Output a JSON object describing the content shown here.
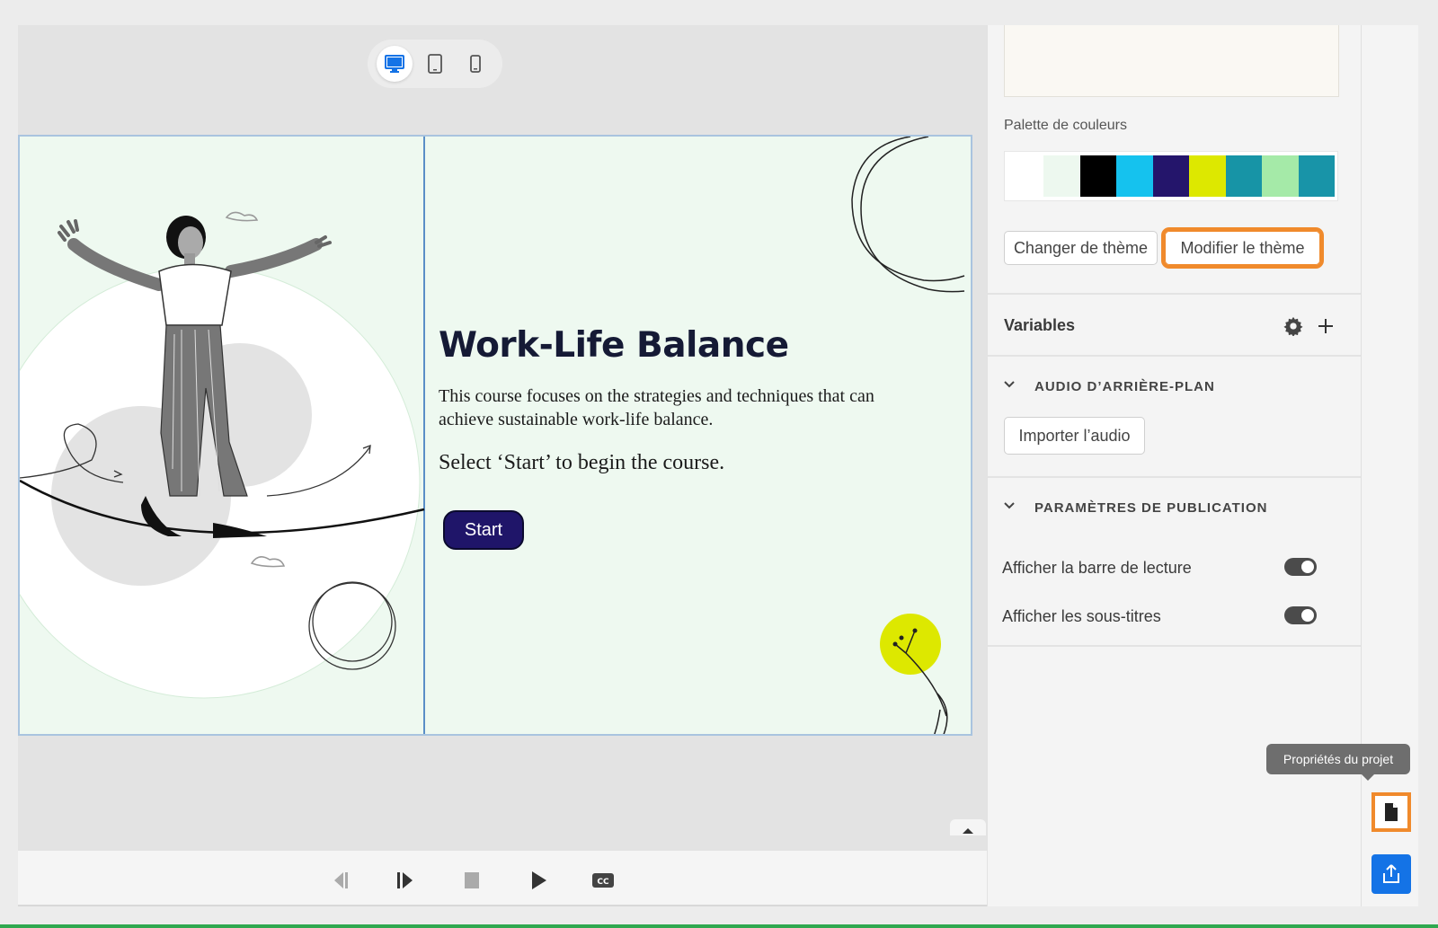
{
  "device_modes": [
    {
      "icon": "desktop-icon",
      "active": true
    },
    {
      "icon": "tablet-icon",
      "active": false
    },
    {
      "icon": "mobile-icon",
      "active": false
    }
  ],
  "slide": {
    "title": "Work-Life Balance",
    "description": "This course focuses on the strategies and techniques that can achieve sustainable work-life balance.",
    "cta": "Select ‘Start’ to begin the course.",
    "start_label": "Start"
  },
  "playbar": {
    "buttons": [
      "previous-icon",
      "next-icon",
      "stop-icon",
      "play-icon",
      "closed-captions-icon"
    ],
    "cc_label": "CC"
  },
  "properties": {
    "palette_label": "Palette de couleurs",
    "palette": [
      "#ffffff",
      "#edf8ef",
      "#000000",
      "#15c2ee",
      "#24156b",
      "#dde800",
      "#1794a6",
      "#a5eaa8",
      "#1894a8"
    ],
    "change_theme_label": "Changer de thème",
    "edit_theme_label": "Modifier le thème",
    "variables_label": "Variables",
    "background_audio": {
      "title": "AUDIO D’ARRIÈRE-PLAN",
      "import_label": "Importer l’audio"
    },
    "publish_settings": {
      "title": "PARAMÈTRES DE PUBLICATION",
      "toggles": [
        {
          "label": "Afficher la barre de lecture",
          "on": true
        },
        {
          "label": "Afficher les sous-titres",
          "on": true
        }
      ]
    }
  },
  "rail": {
    "tooltip": "Propriétés du projet"
  },
  "colors": {
    "highlight": "#f08a2c",
    "publish": "#1473e6",
    "start_button": "#1f1569"
  }
}
